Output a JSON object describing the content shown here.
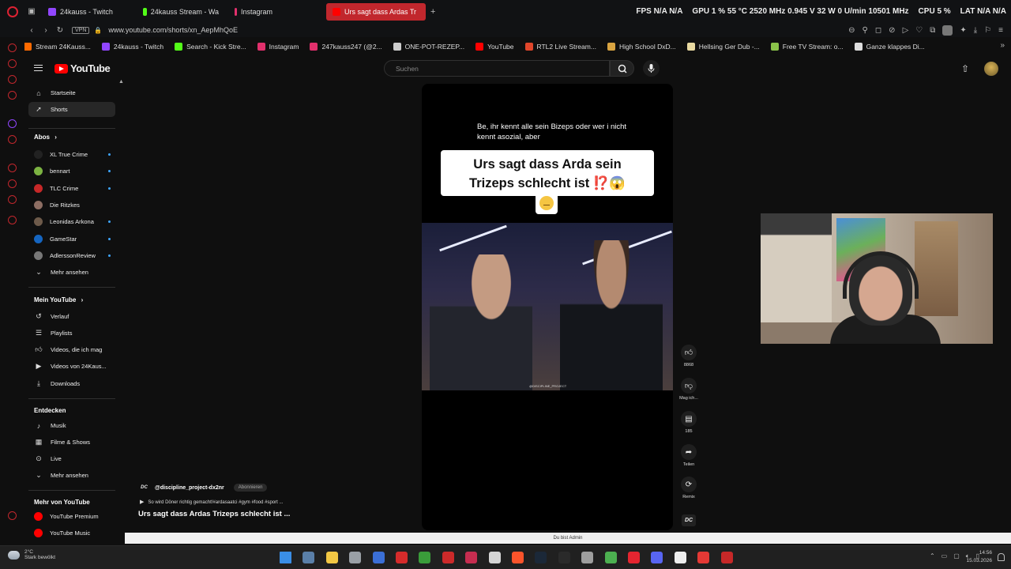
{
  "browser": {
    "tabs": [
      {
        "label": "24kauss - Twitch",
        "color": "#9146ff",
        "active": false
      },
      {
        "label": "24kauss Stream - Wa",
        "color": "#53fc18",
        "active": false
      },
      {
        "label": "Instagram",
        "color": "#e1306c",
        "active": false
      },
      {
        "label": "Urs sagt dass Ardas Tr",
        "color": "#ff0000",
        "active": true
      }
    ],
    "new_tab": "+",
    "hw_stats": {
      "fps": "FPS N/A N/A",
      "gpu": "GPU 1 % 55 °C 2520 MHz 0.945 V 32 W 0 U/min 10501 MHz",
      "cpu": "CPU 5 %",
      "lat": "LAT N/A N/A"
    },
    "vpn": "VPN",
    "url": "www.youtube.com/shorts/xn_AepMhQoE",
    "bookmarks": [
      {
        "label": "Stream 24Kauss...",
        "color": "#ff6a00"
      },
      {
        "label": "24kauss - Twitch",
        "color": "#9146ff"
      },
      {
        "label": "Search - Kick Stre...",
        "color": "#53fc18"
      },
      {
        "label": "Instagram",
        "color": "#e1306c"
      },
      {
        "label": "247kauss247 (@2...",
        "color": "#e1306c"
      },
      {
        "label": "ONE-POT-REZEP...",
        "color": "#cccccc"
      },
      {
        "label": "YouTube",
        "color": "#ff0000"
      },
      {
        "label": "RTL2 Live Stream...",
        "color": "#e0462b"
      },
      {
        "label": "High School DxD...",
        "color": "#d9a441"
      },
      {
        "label": "Hellsing Ger Dub -...",
        "color": "#e8d9a0"
      },
      {
        "label": "Free TV Stream: o...",
        "color": "#8bc34a"
      },
      {
        "label": "Ganze klappes Di...",
        "color": "#dddddd"
      }
    ]
  },
  "youtube": {
    "logo": "YouTube",
    "search_placeholder": "Suchen",
    "sidebar": {
      "main": [
        {
          "label": "Startseite",
          "icon": "home-icon",
          "active": false
        },
        {
          "label": "Shorts",
          "icon": "shorts-icon",
          "active": true
        }
      ],
      "subs_header": "Abos",
      "subs": [
        {
          "label": "XL True Crime",
          "color": "#222222",
          "dot": true
        },
        {
          "label": "bennart",
          "color": "#7cb342",
          "dot": true
        },
        {
          "label": "TLC Crime",
          "color": "#c62828",
          "dot": true
        },
        {
          "label": "Die Ritzkes",
          "color": "#8d6e63",
          "dot": false
        },
        {
          "label": "Leonidas Arkona",
          "color": "#6d5a4a",
          "dot": true
        },
        {
          "label": "GameStar",
          "color": "#1565c0",
          "dot": true
        },
        {
          "label": "AdlerssonReview",
          "color": "#777777",
          "dot": true
        }
      ],
      "more_subs": "Mehr ansehen",
      "you_header": "Mein YouTube",
      "you": [
        {
          "label": "Verlauf",
          "icon": "history-icon"
        },
        {
          "label": "Playlists",
          "icon": "playlists-icon"
        },
        {
          "label": "Videos, die ich mag",
          "icon": "like-icon"
        },
        {
          "label": "Videos von 24Kaus...",
          "icon": "your-videos-icon"
        },
        {
          "label": "Downloads",
          "icon": "download-icon"
        }
      ],
      "explore_header": "Entdecken",
      "explore": [
        {
          "label": "Musik",
          "icon": "music-icon"
        },
        {
          "label": "Filme & Shows",
          "icon": "film-icon"
        },
        {
          "label": "Live",
          "icon": "live-icon"
        }
      ],
      "more_explore": "Mehr ansehen",
      "more_header": "Mehr von YouTube",
      "more": [
        {
          "label": "YouTube Premium",
          "color": "#ff0000"
        },
        {
          "label": "YouTube Music",
          "color": "#ff0000"
        }
      ]
    },
    "short": {
      "caption": "Be, ihr kennt alle sein Bizeps oder wer i nicht kennt asozial, aber",
      "title_line1": "Urs sagt dass Arda sein",
      "title_line2": "Trizeps schlecht ist ⁉️😱",
      "watermark": "@DISCIPLINE_PROJECT",
      "channel_logo": "DC",
      "channel": "@discipline_project-dx2nr",
      "subscribe": "Abonnieren",
      "description": "So wird Döner richtig gemacht!#ardasaatci #gym #food #sport ...",
      "video_title": "Urs sagt dass Ardas Trizeps schlecht ist ..."
    },
    "actions": {
      "likes": "8868",
      "dislike": "Mag ich...",
      "comments": "185",
      "share": "Teilen",
      "remix": "Remix"
    },
    "status": "Du bist Admin"
  },
  "taskbar": {
    "weather_temp": "2°C",
    "weather_text": "Stark bewölkt",
    "time": "14:56",
    "date": "15.03.2026",
    "apps": [
      {
        "name": "windows-start",
        "color": "#3a8ee6"
      },
      {
        "name": "calculator",
        "color": "#5a7fa8"
      },
      {
        "name": "file-explorer",
        "color": "#f2c744"
      },
      {
        "name": "mouse-app",
        "color": "#9aa0a6"
      },
      {
        "name": "vscode-like",
        "color": "#3b6fd6"
      },
      {
        "name": "red-app",
        "color": "#d62b2b"
      },
      {
        "name": "store",
        "color": "#3a9c3a"
      },
      {
        "name": "media",
        "color": "#cc2a2a"
      },
      {
        "name": "recorder",
        "color": "#c62d50"
      },
      {
        "name": "vpn-app",
        "color": "#d4d4d4"
      },
      {
        "name": "brave",
        "color": "#fb542b"
      },
      {
        "name": "steam",
        "color": "#1b2838"
      },
      {
        "name": "epic",
        "color": "#2a2a2a"
      },
      {
        "name": "gear-app",
        "color": "#9e9e9e"
      },
      {
        "name": "chrome",
        "color": "#4caf50"
      },
      {
        "name": "opera",
        "color": "#e52530"
      },
      {
        "name": "discord",
        "color": "#5865f2"
      },
      {
        "name": "notepad",
        "color": "#eeeeee"
      },
      {
        "name": "pdf",
        "color": "#e53935"
      },
      {
        "name": "media2",
        "color": "#c62828"
      }
    ]
  }
}
